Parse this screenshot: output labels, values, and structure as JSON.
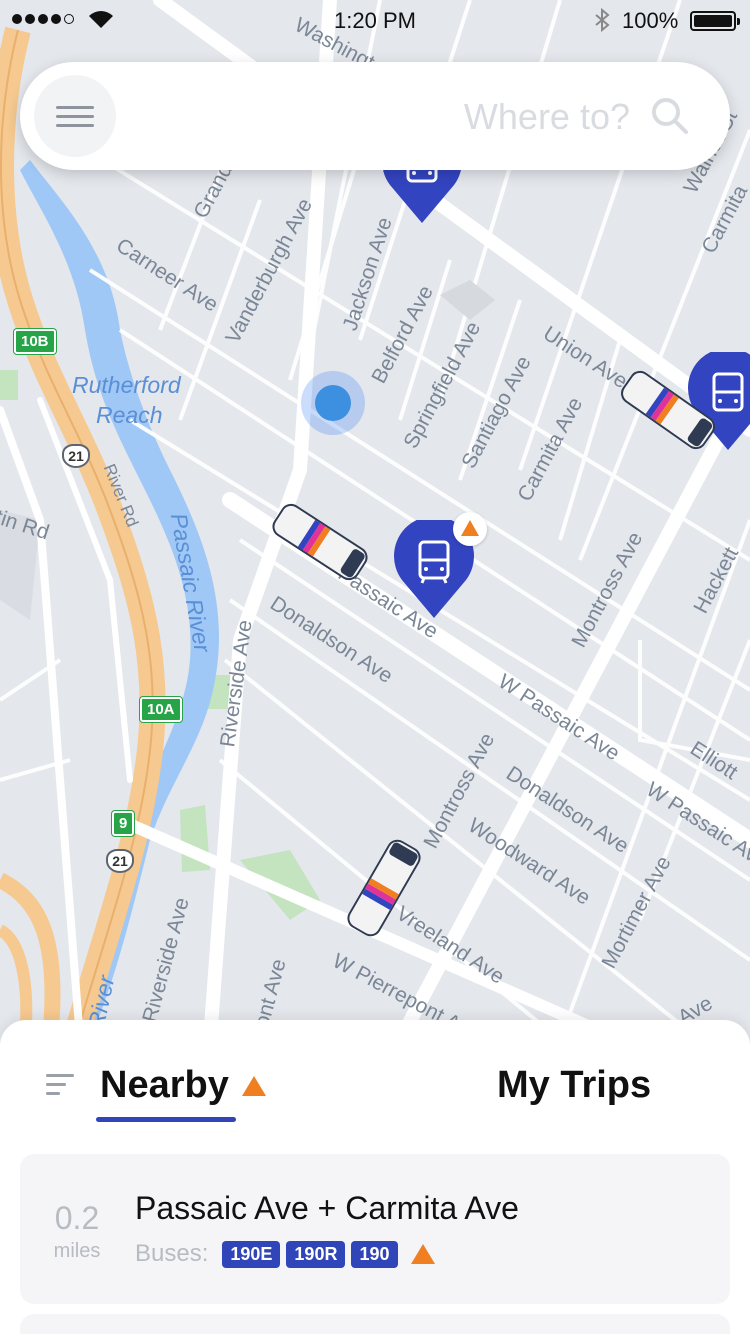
{
  "status_bar": {
    "time": "1:20 PM",
    "battery": "100%",
    "signal_icon": "signal-dots-icon",
    "wifi_icon": "wifi-icon",
    "bluetooth_icon": "bluetooth-icon"
  },
  "search": {
    "placeholder": "Where to?",
    "menu_icon": "hamburger-icon",
    "search_icon": "search-icon"
  },
  "map": {
    "streets": [
      "Washington Ave",
      "Grand Ave",
      "Carneer Ave",
      "Vanderburgh Ave",
      "Jackson Ave",
      "Belford Ave",
      "Springfield Ave",
      "Santiago Ave",
      "Union Ave",
      "Carmita Ave",
      "Walnut St",
      "Carmita",
      "River Rd",
      "Passaic Ave",
      "Donaldson Ave",
      "Riverside Ave",
      "Montross Ave",
      "W Passaic Ave",
      "Hackett",
      "Elliott",
      "Woodward Ave",
      "Mortimer Ave",
      "Vreeland Ave",
      "W Pierrepont Ave",
      "Riverside Ave",
      "ont Ave",
      "tin Rd",
      "Ave"
    ],
    "water": [
      "Rutherford",
      "Reach",
      "Passaic River",
      "River"
    ],
    "exits": [
      "10B",
      "10A",
      "9"
    ],
    "routes": [
      "21",
      "21"
    ],
    "pin_icon": "bus-stop-pin-icon",
    "alert_icon": "warning-triangle-icon",
    "bus_icon": "bus-icon",
    "location_icon": "user-location-icon",
    "colors": {
      "pin": "#3344c0",
      "alert": "#f07f22",
      "water": "#9fc8f6",
      "highway": "#f5c98f",
      "park": "#c4e3bf"
    }
  },
  "sheet": {
    "tabs": [
      {
        "label": "Nearby",
        "active": true,
        "alert": true
      },
      {
        "label": "My Trips",
        "active": false
      }
    ],
    "sort_icon": "sort-icon",
    "stops": [
      {
        "distance": "0.2",
        "unit": "miles",
        "name": "Passaic Ave + Carmita Ave",
        "buses_label": "Buses:",
        "routes": [
          "190E",
          "190R",
          "190"
        ],
        "alert": true
      }
    ]
  }
}
